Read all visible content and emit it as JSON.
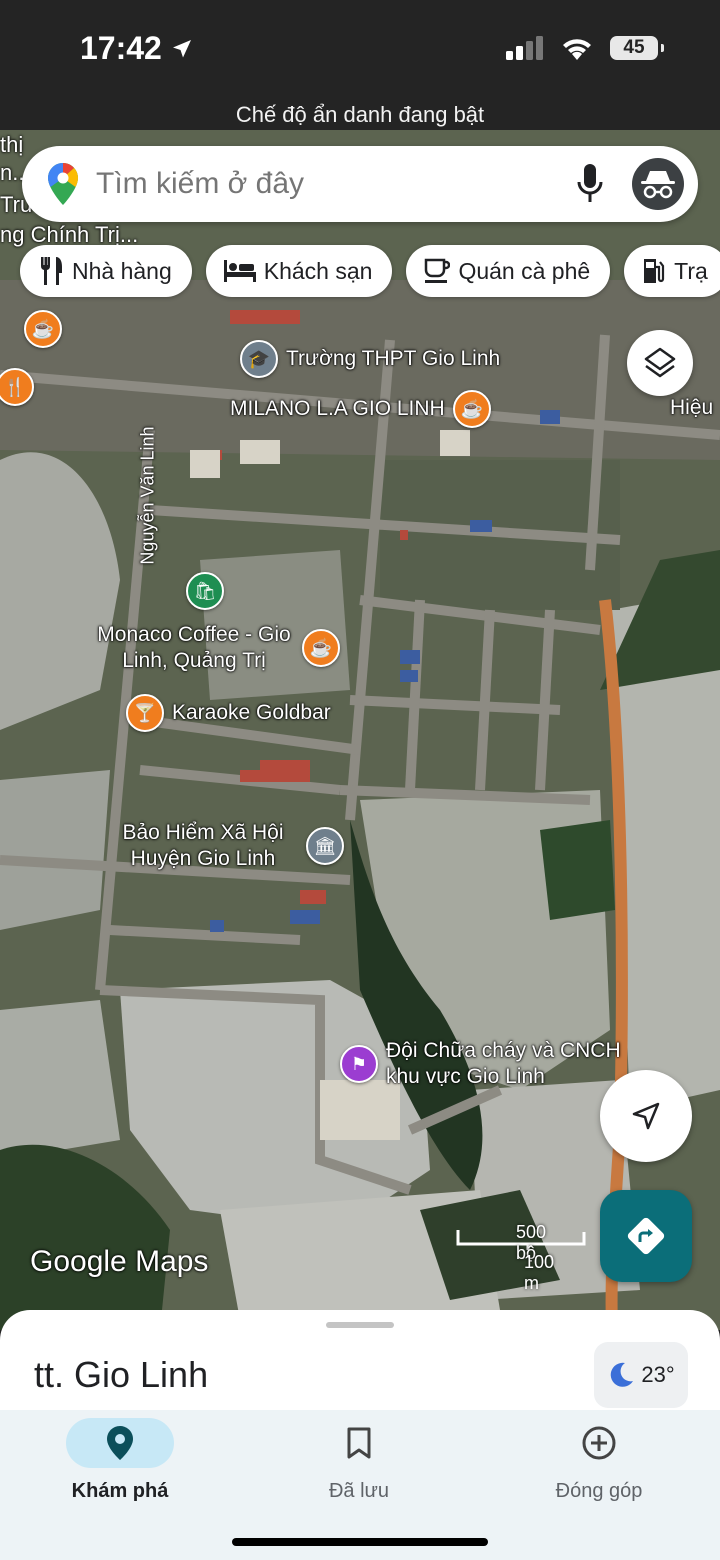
{
  "status_bar": {
    "time": "17:42",
    "battery": "45",
    "incognito_banner": "Chế độ ẩn danh đang bật"
  },
  "search": {
    "placeholder": "Tìm kiếm ở đây",
    "icons": [
      "google-maps-pin-icon",
      "mic-icon",
      "incognito-icon"
    ]
  },
  "chips": [
    {
      "label": "Nhà hàng",
      "icon": "fork-knife-icon"
    },
    {
      "label": "Khách sạn",
      "icon": "bed-icon"
    },
    {
      "label": "Quán cà phê",
      "icon": "coffee-cup-icon"
    },
    {
      "label": "Trạ",
      "icon": "fuel-pump-icon"
    }
  ],
  "map": {
    "edge_labels": [
      "thị",
      "n...",
      "Trư",
      "ng Chính Trị..."
    ],
    "street": "Nguyễn Văn Linh",
    "pois": [
      {
        "label": "Trường THPT Gio Linh",
        "icon": "school-icon"
      },
      {
        "label": "MILANO L.A GIO LINH",
        "icon": "coffee-icon"
      },
      {
        "label": "Hiệu",
        "icon": ""
      },
      {
        "label": "Monaco Coffee - Gio Linh, Quảng Trị",
        "icon": "coffee-icon"
      },
      {
        "label": "Karaoke Goldbar",
        "icon": "cocktail-icon"
      },
      {
        "label": "Bảo Hiểm Xã Hội Huyện Gio Linh",
        "icon": "government-icon"
      },
      {
        "label": "Đội Chữa cháy và CNCH khu vực Gio Linh",
        "icon": "fire-station-icon"
      }
    ],
    "watermark": "Google Maps",
    "scale": {
      "top": "500 bộ",
      "bottom": "100 m"
    }
  },
  "sheet": {
    "title": "tt. Gio Linh",
    "weather": "23°"
  },
  "bottom_nav": [
    {
      "label": "Khám phá",
      "icon": "location-pin-icon",
      "active": true
    },
    {
      "label": "Đã lưu",
      "icon": "bookmark-icon",
      "active": false
    },
    {
      "label": "Đóng góp",
      "icon": "add-circle-icon",
      "active": false
    }
  ],
  "colors": {
    "accent": "#0b6e79",
    "poi_orange": "#f07d1e",
    "nav_active": "#c7e8f6"
  }
}
